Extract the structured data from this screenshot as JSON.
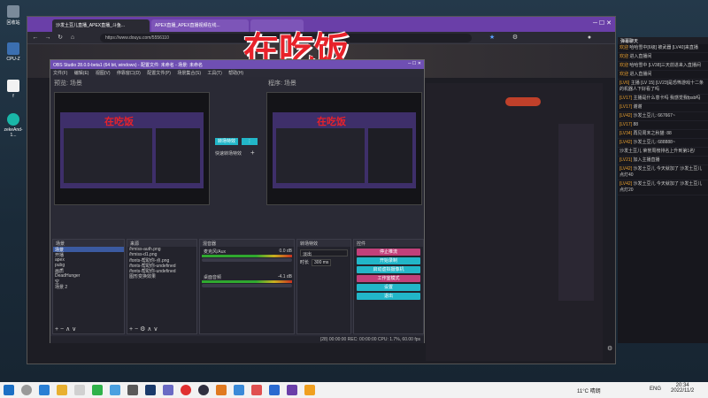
{
  "desktop_icons": [
    {
      "label": "回收站",
      "icon": "recycle-bin-icon"
    },
    {
      "label": "CPU-Z",
      "icon": "cpu-icon"
    },
    {
      "label": "f",
      "icon": "file-icon"
    },
    {
      "label": "zekeAnd-1...",
      "icon": "app-icon"
    }
  ],
  "browser": {
    "tabs": [
      {
        "label": "沙发土豆儿直播_APEX直播_斗鱼...",
        "active": true
      },
      {
        "label": "APEX直播_APEX直播视频在线...",
        "active": false
      },
      {
        "label": "",
        "active": false
      }
    ],
    "url": "https://www.douyu.com/5556110"
  },
  "overlay_title": "在吃饭",
  "obs": {
    "title": "OBS Studio 28.0.0-beta1 (64 bit, windows) - 配置文件: 未命名 - 场景: 未命名",
    "menu": [
      "文件(F)",
      "编辑(E)",
      "视图(V)",
      "停靠窗口(D)",
      "配置文件(P)",
      "场景集合(S)",
      "工具(T)",
      "帮助(H)"
    ],
    "preview_label": "预览: 场景",
    "program_label": "程序: 场景",
    "transition_button": "转场特效",
    "quick_transition": "快速转场特效",
    "mini_title": "在吃饭",
    "docks": {
      "scenes": "场景",
      "sources": "来源",
      "mixer": "混音器",
      "transitions": "转场特效",
      "controls": "控件"
    },
    "scenes": [
      "场景",
      "开播",
      "apex",
      "pubg",
      "画质",
      "DeadHunger",
      "空",
      "场景 2"
    ],
    "sources": [
      "/hmiss-auth.png",
      "/hmiss-d1.png",
      "/fonts-帮助你-点.png",
      "/fonts-帮助你-undefined",
      "/fonts-帮助你-undefined",
      "图形变换效果"
    ],
    "mixer": [
      {
        "name": "麦克风/Aux",
        "db": "0.0 dB"
      },
      {
        "name": "桌面音频",
        "db": "-4.1 dB"
      }
    ],
    "transition_type": "淡出",
    "transition_duration_label": "时长",
    "transition_duration": "300 ms",
    "controls": [
      "停止推流",
      "开始录制",
      "启动虚拟摄像机",
      "工作室模式",
      "设置",
      "退出"
    ],
    "status": "(28) 00:00:00   REC: 00:00:00   CPU: 1.7%, 60.00 fps"
  },
  "chat": {
    "title": "弹幕聊天",
    "messages": [
      {
        "user": "欢迎",
        "text": "哈哈雪中[6级] 被武器 [LV40]来直播"
      },
      {
        "user": "欢迎",
        "text": "进入直播间"
      },
      {
        "user": "欢迎",
        "text": "哈哈雪中 [LV38]三天前进来入直播间"
      },
      {
        "user": "欢迎",
        "text": "进入直播间"
      },
      {
        "user": "[LV6]",
        "text": "主播 [LV 15] [LV23]是恐怖游戏十二条的机器人下好看了吗"
      },
      {
        "user": "[LV17]",
        "text": "主播是什么意卡吗 我感觉我fpsb吗"
      },
      {
        "user": "[LV17]",
        "text": "谢谢"
      },
      {
        "user": "[LV42]",
        "text": "沙发土豆儿: 667667~"
      },
      {
        "user": "[LV17]",
        "text": "88"
      },
      {
        "user": "[LV34]",
        "text": "再见周末之秋猫: 88"
      },
      {
        "user": "[LV42]",
        "text": "沙发土豆儿: 688888~"
      },
      {
        "user": "",
        "text": "沙发土豆儿 荣誉周榜排名上升到第1名!"
      },
      {
        "user": "[LV21]",
        "text": "加入主播直播"
      },
      {
        "user": "[LV42]",
        "text": "沙发土豆儿 今天就加了 沙发土豆儿 点灯40"
      },
      {
        "user": "[LV42]",
        "text": "沙发土豆儿 今天就加了 沙发土豆儿 点灯20"
      }
    ]
  },
  "taskbar": {
    "weather": "11°C 晴朗",
    "lang": "ENG",
    "time": "20:34",
    "date": "2022/11/2"
  }
}
